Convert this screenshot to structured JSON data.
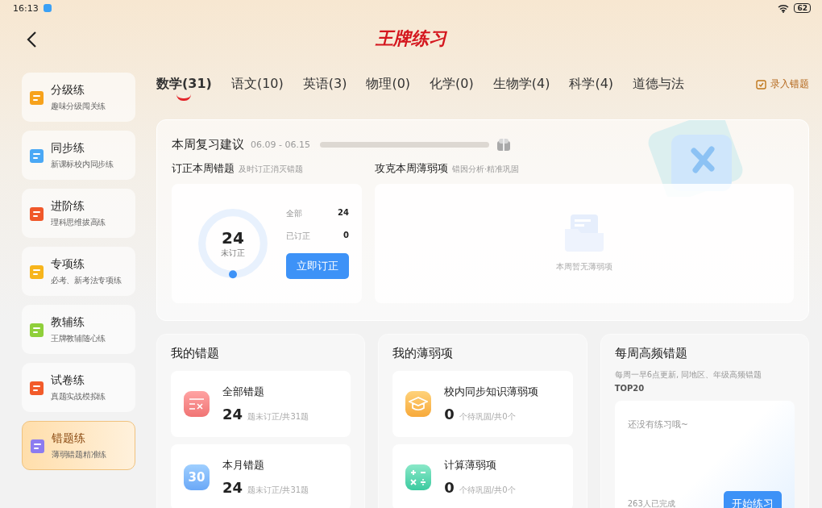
{
  "status_bar": {
    "time": "16:13",
    "battery": "62"
  },
  "header": {
    "title": "王牌练习"
  },
  "sidebar": {
    "items": [
      {
        "kind": "grade",
        "title": "分级练",
        "subtitle": "趣味分级闯关练",
        "selected": false
      },
      {
        "kind": "sync",
        "title": "同步练",
        "subtitle": "新课标校内同步练",
        "selected": false
      },
      {
        "kind": "advance",
        "title": "进阶练",
        "subtitle": "理科思维拔高练",
        "selected": false
      },
      {
        "kind": "special",
        "title": "专项练",
        "subtitle": "必考、新考法专项练",
        "selected": false
      },
      {
        "kind": "book",
        "title": "教辅练",
        "subtitle": "王牌教辅随心练",
        "selected": false
      },
      {
        "kind": "paper",
        "title": "试卷练",
        "subtitle": "真题实战模拟练",
        "selected": false
      },
      {
        "kind": "mistake",
        "title": "错题练",
        "subtitle": "薄弱错题精准练",
        "selected": true
      }
    ]
  },
  "tabs": [
    {
      "label": "数学(31)",
      "selected": true
    },
    {
      "label": "语文(10)",
      "selected": false
    },
    {
      "label": "英语(3)",
      "selected": false
    },
    {
      "label": "物理(0)",
      "selected": false
    },
    {
      "label": "化学(0)",
      "selected": false
    },
    {
      "label": "生物学(4)",
      "selected": false
    },
    {
      "label": "科学(4)",
      "selected": false
    },
    {
      "label": "道德与法",
      "selected": false
    }
  ],
  "record_button": "录入错题",
  "review": {
    "title": "本周复习建议",
    "dates": "06.09 - 06.15",
    "correct": {
      "title": "订正本周错题",
      "hint": "及时订正消灭错题",
      "count": "24",
      "count_label": "未订正",
      "level": 0,
      "stats": [
        {
          "label": "全部",
          "value": "24"
        },
        {
          "label": "已订正",
          "value": "0"
        }
      ],
      "button": "立即订正"
    },
    "weak": {
      "title": "攻克本周薄弱项",
      "hint": "错因分析·精准巩固",
      "empty": "本周暂无薄弱项"
    }
  },
  "my_mistakes": {
    "title": "我的错题",
    "items": [
      {
        "kind": "all",
        "name": "全部错题",
        "count": "24",
        "detail": "题未订正/共31题"
      },
      {
        "kind": "month",
        "icon_label": "30",
        "name": "本月错题",
        "count": "24",
        "detail": "题未订正/共31题"
      }
    ]
  },
  "my_weak": {
    "title": "我的薄弱项",
    "items": [
      {
        "kind": "school",
        "name": "校内同步知识薄弱项",
        "count": "0",
        "detail": "个待巩固/共0个"
      },
      {
        "kind": "calc",
        "name": "计算薄弱项",
        "count": "0",
        "detail": "个待巩固/共0个"
      }
    ]
  },
  "weekly": {
    "title": "每周高频错题",
    "desc": "每周一早6点更新, 同地区、年级高频错题",
    "tag": "TOP20",
    "empty": "还没有练习哦~",
    "done": "263人已完成",
    "button": "开始练习"
  }
}
